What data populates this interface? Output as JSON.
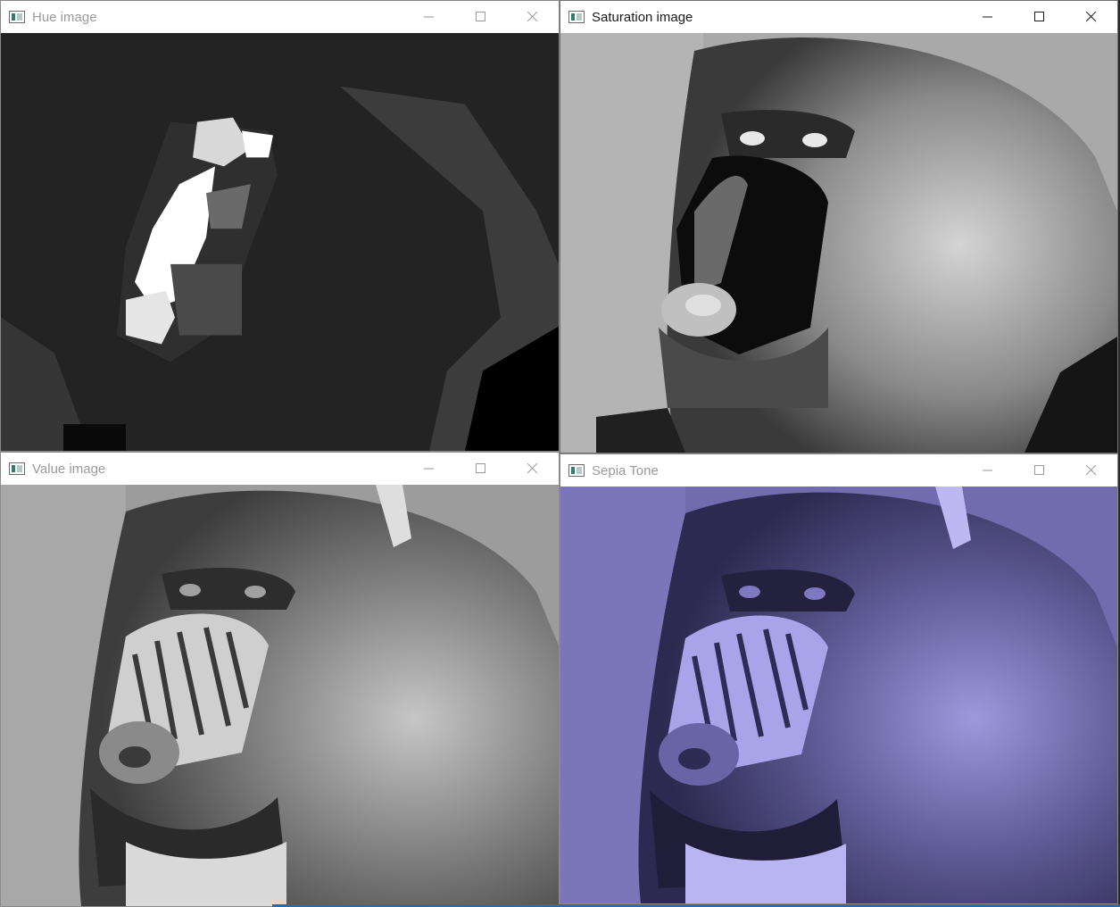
{
  "windows": [
    {
      "id": "hue",
      "title": "Hue image",
      "active": false
    },
    {
      "id": "saturation",
      "title": "Saturation image",
      "active": true
    },
    {
      "id": "value",
      "title": "Value image",
      "active": false
    },
    {
      "id": "sepia",
      "title": "Sepia Tone",
      "active": false
    }
  ],
  "controls": {
    "minimize": "minimize-icon",
    "maximize": "maximize-icon",
    "close": "close-icon"
  },
  "colors": {
    "hue_bg": "#1e1e1e",
    "saturation_bg": "#9a9a9a",
    "value_bg": "#8e8e8e",
    "sepia_bg": "#5a5890",
    "taskbar_accent": "#1f6fb5"
  }
}
